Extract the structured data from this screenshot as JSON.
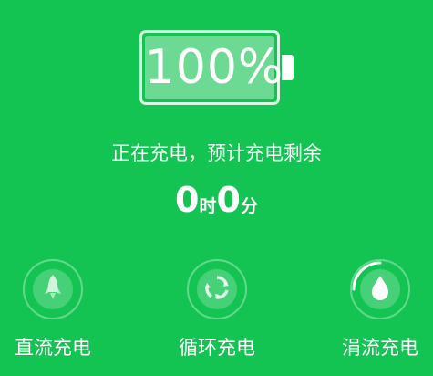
{
  "battery": {
    "percent_text": "100%",
    "level": 1.0
  },
  "status": {
    "text": "正在充电，预计充电剩余",
    "hours": "0",
    "hours_unit": "时",
    "minutes": "0",
    "minutes_unit": "分"
  },
  "modes": [
    {
      "label": "直流充电",
      "icon": "rocket-icon",
      "active": false
    },
    {
      "label": "循环充电",
      "icon": "recycle-icon",
      "active": false
    },
    {
      "label": "涓流充电",
      "icon": "water-drop-icon",
      "active": true
    }
  ],
  "colors": {
    "background": "#13C452",
    "foreground": "#FFFFFF"
  }
}
